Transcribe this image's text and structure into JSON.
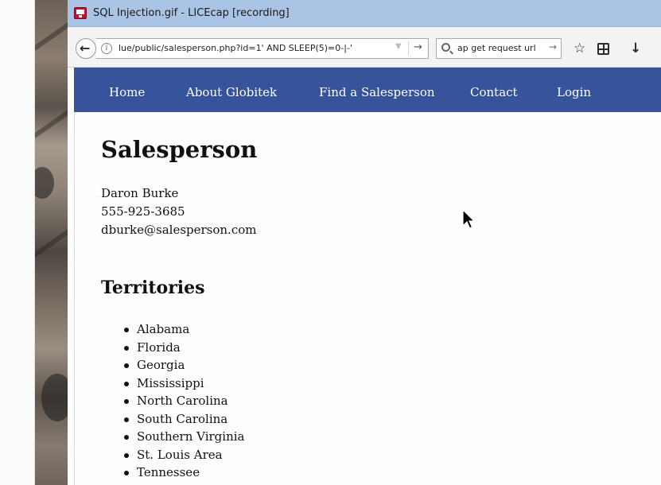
{
  "window": {
    "title": "SQL Injection.gif - LICEcap [recording]"
  },
  "browser": {
    "url": "lue/public/salesperson.php?id=1' AND SLEEP(5)=0-|-'",
    "search_query": "ap get request url",
    "icons": {
      "back": "back-arrow-icon",
      "info": "info-icon",
      "dropdown": "dropdown-arrow-icon",
      "go": "go-arrow-icon",
      "search": "search-icon",
      "star": "star-icon",
      "reader": "reader-view-icon",
      "download": "download-icon"
    }
  },
  "site": {
    "nav": [
      {
        "label": "Home"
      },
      {
        "label": "About Globitek"
      },
      {
        "label": "Find a Salesperson"
      },
      {
        "label": "Contact"
      },
      {
        "label": "Login"
      }
    ],
    "accent": "#36539b"
  },
  "page": {
    "heading": "Salesperson",
    "name": "Daron Burke",
    "phone": "555-925-3685",
    "email": "dburke@salesperson.com",
    "territories_heading": "Territories",
    "territories": [
      "Alabama",
      "Florida",
      "Georgia",
      "Mississippi",
      "North Carolina",
      "South Carolina",
      "Southern Virginia",
      "St. Louis Area",
      "Tennessee"
    ]
  }
}
